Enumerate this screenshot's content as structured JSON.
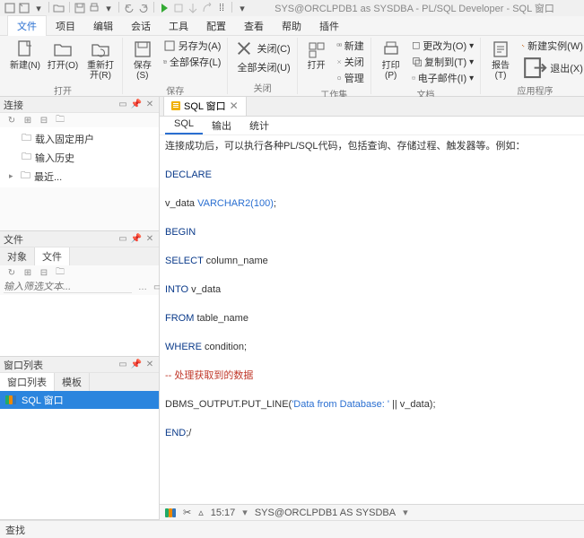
{
  "titlebar": {
    "title": "SYS@ORCLPDB1 as SYSDBA - PL/SQL Developer - SQL 窗口"
  },
  "menu": {
    "items": [
      "文件",
      "项目",
      "编辑",
      "会话",
      "工具",
      "配置",
      "查看",
      "帮助",
      "插件"
    ]
  },
  "ribbon": {
    "g1": {
      "new": "新建(N)",
      "open": "打开(O)",
      "reopen": "重新打开(R)",
      "label": "打开"
    },
    "g2": {
      "save": "保存(S)",
      "saveas": "另存为(A)",
      "saveall": "全部保存(L)",
      "label": "保存"
    },
    "g3": {
      "close": "关闭(C)",
      "closeall": "全部关闭(U)",
      "label": "关闭"
    },
    "g4": {
      "open": "打开",
      "new": "新建",
      "close": "关闭",
      "manage": "管理",
      "label": "工作集"
    },
    "g5": {
      "print": "打印(P)",
      "setup": "更改为(O)",
      "copyto": "复制到(T)",
      "email": "电子邮件(I)",
      "label": "文档"
    },
    "g6": {
      "report": "报告(T)",
      "instance": "新建实例(W)",
      "exit": "退出(X)",
      "label": "应用程序"
    }
  },
  "panels": {
    "connect": {
      "title": "连接",
      "items": [
        "载入固定用户",
        "输入历史",
        "最近..."
      ]
    },
    "file": {
      "title": "文件",
      "tabs": [
        "对象",
        "文件"
      ],
      "placeholder": "输入筛选文本..."
    },
    "winlist": {
      "title": "窗口列表",
      "tabs": [
        "窗口列表",
        "模板"
      ],
      "item": "SQL 窗口"
    }
  },
  "editor": {
    "tab": "SQL 窗口",
    "subtabs": [
      "SQL",
      "输出",
      "统计"
    ],
    "desc": "连接成功后，可以执行各种PL/SQL代码，包括查询、存储过程、触发器等。例如：",
    "lines": {
      "declare": "DECLARE",
      "vdata1": "v_data ",
      "vdata2": "VARCHAR2(100)",
      "semicolon": ";",
      "begin": "BEGIN",
      "select": "SELECT",
      "colname": " column_name",
      "into": "INTO",
      "vd": " v_data",
      "from": "FROM",
      "tbl": " table_name",
      "where": "WHERE",
      "cond": " condition;",
      "comment": "-- 处理获取到的数据",
      "dbms1": "DBMS_OUTPUT.PUT_LINE(",
      "dbms2": "'Data from Database: '",
      "dbms3": " || v_data);",
      "end": "END",
      "endsemi": ";/"
    }
  },
  "status": {
    "time": "15:17",
    "conn": "SYS@ORCLPDB1 AS SYSDBA"
  },
  "find": {
    "label": "查找"
  }
}
